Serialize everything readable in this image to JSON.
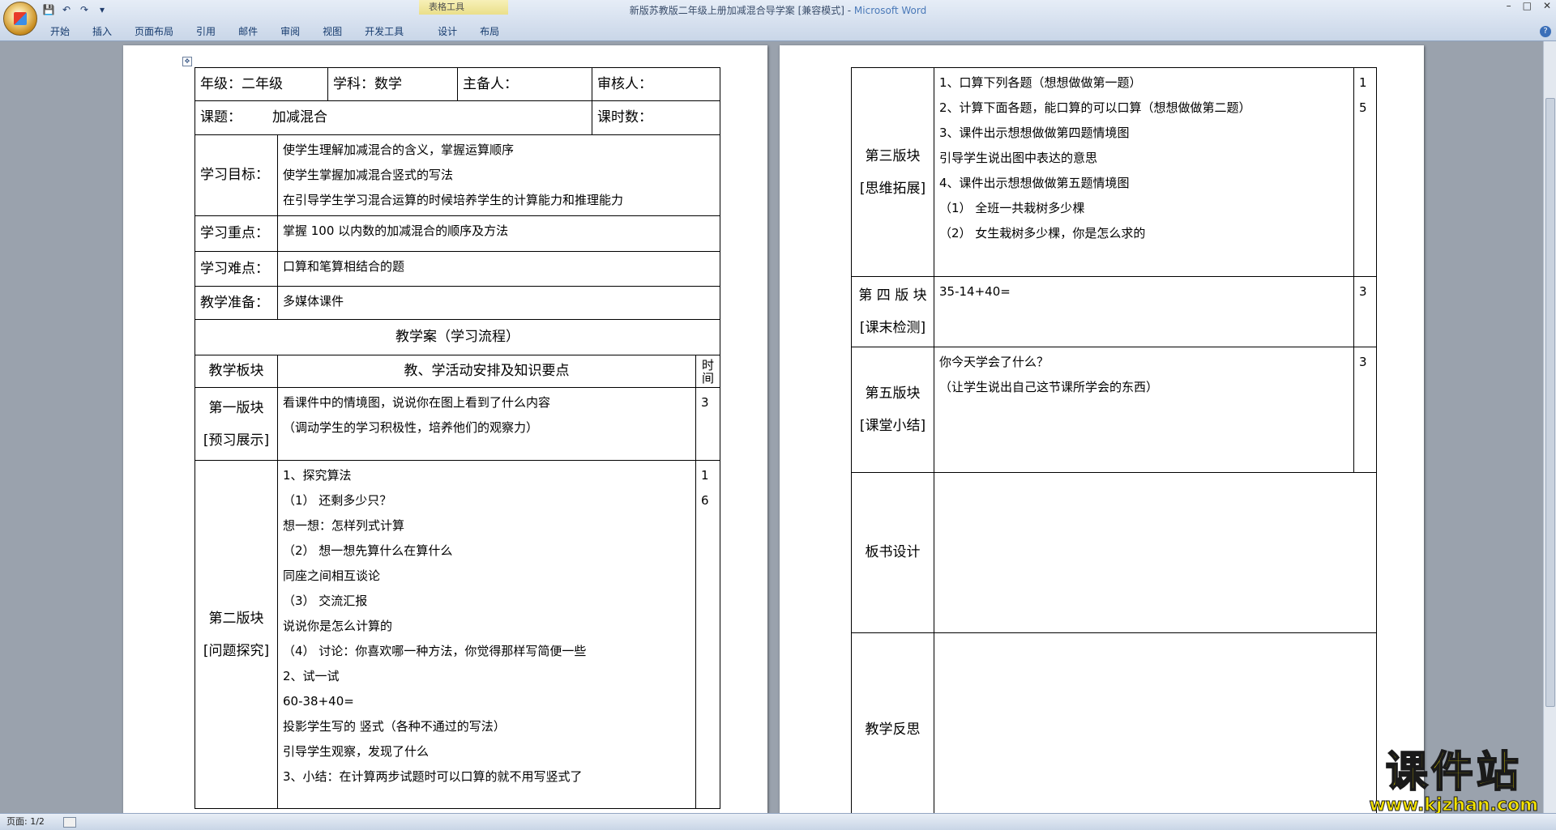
{
  "window": {
    "title": "新版苏教版二年级上册加减混合导学案 [兼容模式] - ",
    "app_name": "Microsoft Word",
    "contextual_tab_group": "表格工具",
    "controls": [
      "–",
      "□",
      "✕"
    ]
  },
  "ribbon": {
    "tabs": [
      "开始",
      "插入",
      "页面布局",
      "引用",
      "邮件",
      "审阅",
      "视图",
      "开发工具",
      "设计",
      "布局"
    ]
  },
  "status": {
    "page": "页面: 1/2"
  },
  "watermark": {
    "main": "课件站",
    "url": "www.kjzhan.com"
  },
  "page1": {
    "header": {
      "grade": "年级：二年级",
      "subject": "学科：数学",
      "preparer": "主备人：",
      "reviewer": "审核人："
    },
    "topic_label": "课题：",
    "topic": "加减混合",
    "hours_label": "课时数：",
    "goals_label": "学习目标：",
    "goals": [
      "使学生理解加减混合的含义，掌握运算顺序",
      "使学生掌握加减混合竖式的写法",
      "在引导学生学习混合运算的时候培养学生的计算能力和推理能力"
    ],
    "focus_label": "学习重点：",
    "focus": "掌握 100 以内数的加减混合的顺序及方法",
    "difficulty_label": "学习难点：",
    "difficulty": "口算和笔算相结合的题",
    "prep_label": "教学准备：",
    "prep": "多媒体课件",
    "plan_title": "教学案（学习流程）",
    "col_block": "教学板块",
    "col_activity": "教、学活动安排及知识要点",
    "col_time": "时间",
    "block1": {
      "name": "第一版块",
      "sub": "[预习展示]",
      "lines": [
        "看课件中的情境图，说说你在图上看到了什么内容",
        "（调动学生的学习积极性，培养他们的观察力）"
      ],
      "time": "3"
    },
    "block2": {
      "name": "第二版块",
      "sub": "[问题探究]",
      "lines": [
        "1、探究算法",
        "（1）  还剩多少只？",
        "  想一想：怎样列式计算",
        "（2）  想一想先算什么在算什么",
        "  同座之间相互谈论",
        "（3）  交流汇报",
        "  说说你是怎么计算的",
        "（4）  讨论：你喜欢哪一种方法，你觉得那样写简便一些",
        "2、试一试",
        "60-38+40=",
        "投影学生写的 竖式（各种不通过的写法）",
        "引导学生观察，发现了什么",
        "3、小结：在计算两步试题时可以口算的就不用写竖式了"
      ],
      "time": [
        "1",
        "6"
      ]
    }
  },
  "page2": {
    "block3": {
      "name": "第三版块",
      "sub": "[思维拓展]",
      "lines": [
        "1、口算下列各题（想想做做第一题）",
        "2、计算下面各题，能口算的可以口算（想想做做第二题）",
        "3、课件出示想想做做第四题情境图",
        "    引导学生说出图中表达的意思",
        "4、课件出示想想做做第五题情境图",
        "（1）  全班一共栽树多少棵",
        "（2）  女生栽树多少棵，你是怎么求的"
      ],
      "time": [
        "1",
        "5"
      ]
    },
    "block4": {
      "name": "第 四 版 块",
      "sub": "[课末检测]",
      "lines": [
        "35-14+40="
      ],
      "time": "3"
    },
    "block5": {
      "name": "第五版块",
      "sub": "[课堂小结]",
      "lines": [
        "你今天学会了什么？",
        "（让学生说出自己这节课所学会的东西）"
      ],
      "time": "3"
    },
    "board_label": "板书设计",
    "reflection_label": "教学反思"
  }
}
